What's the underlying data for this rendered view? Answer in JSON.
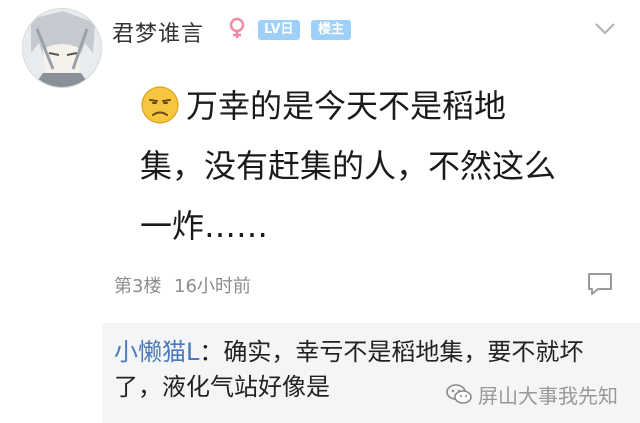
{
  "post": {
    "username": "君梦谁言",
    "gender_icon": "female-icon",
    "level_badge": "LV日",
    "op_badge": "楼主",
    "content_lines": [
      "万幸的是今天不是稻地",
      "集，没有赶集的人，不然这么",
      "一炸……"
    ],
    "emoji": "frowning-face-emoji",
    "floor": "第3楼",
    "time": "16小时前"
  },
  "reply": {
    "author": "小懒猫L",
    "colon": "：",
    "text_line1": "确实，幸亏不是稻地集，要不就坏",
    "text_line2": "了，液化气站好像是"
  },
  "watermark": {
    "text": "屏山大事我先知",
    "icon": "wechat-logo-icon"
  },
  "colors": {
    "badge": "#9fd0f7",
    "gender": "#f08aa5",
    "author_link": "#4a7ab8",
    "reply_bg": "#f4f5f7"
  }
}
